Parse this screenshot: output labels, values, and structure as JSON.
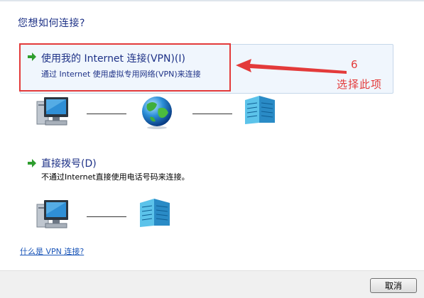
{
  "dialog": {
    "heading": "您想如何连接?",
    "options": [
      {
        "title": "使用我的 Internet 连接(VPN)(I)",
        "description": "通过 Internet 使用虚拟专用网络(VPN)来连接"
      },
      {
        "title": "直接拨号(D)",
        "description": "不通过Internet直接使用电话号码来连接。"
      }
    ],
    "help_link": "什么是 VPN 连接?",
    "cancel_label": "取消"
  },
  "annotation": {
    "number": "6",
    "text": "选择此项",
    "color": "#e33a3a"
  },
  "colors": {
    "heading": "#1e3287",
    "link": "#1a55b8",
    "accent_green": "#2e9e2e"
  }
}
